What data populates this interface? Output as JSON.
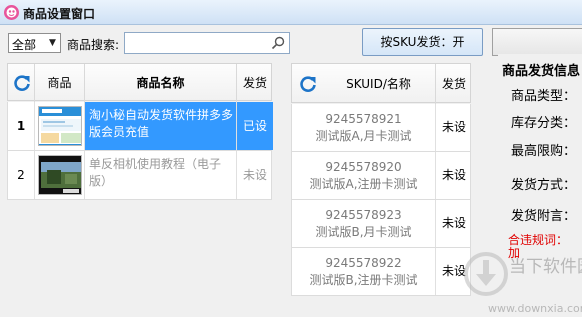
{
  "window": {
    "title": "商品设置窗口"
  },
  "toolbar": {
    "category_selected": "全部",
    "search_label": "商品搜索:",
    "search_value": "",
    "sku_toggle_label": "按SKU发货：开"
  },
  "product_table": {
    "columns": [
      "商品",
      "商品名称",
      "发货"
    ],
    "rows": [
      {
        "num": "1",
        "name": "淘小秘自动发货软件拼多多版会员充值",
        "status": "已设"
      },
      {
        "num": "2",
        "name": "单反相机使用教程（电子版）",
        "status": "未设"
      }
    ]
  },
  "sku_table": {
    "columns": [
      "SKUID/名称",
      "发货"
    ],
    "rows": [
      {
        "id": "9245578921",
        "name": "测试版A,月卡测试",
        "status": "未设"
      },
      {
        "id": "9245578920",
        "name": "测试版A,注册卡测试",
        "status": "未设"
      },
      {
        "id": "9245578923",
        "name": "测试版B,月卡测试",
        "status": "未设"
      },
      {
        "id": "9245578922",
        "name": "测试版B,注册卡测试",
        "status": "未设"
      }
    ]
  },
  "info_panel": {
    "title": "商品发货信息",
    "labels": [
      "商品类型：",
      "库存分类：",
      "最高限购：",
      "发货方式：",
      "发货附言："
    ],
    "rule_label": "合违规词：加"
  },
  "watermark": {
    "line1": "当下软件园",
    "url": "www.downxia.com"
  },
  "colors": {
    "selected_row": "#3399ff",
    "rule_text": "#e00000",
    "title_bar": "#cfe1f5"
  }
}
